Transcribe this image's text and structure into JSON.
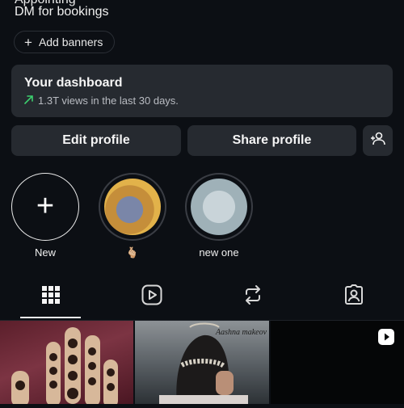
{
  "profile": {
    "bio_cut": "Appointing",
    "bio_line": "DM for bookings",
    "add_banners_label": "Add banners"
  },
  "dashboard": {
    "title": "Your dashboard",
    "subtitle": "1.3T views in the last 30 days.",
    "trend_icon": "trend-up-icon",
    "trend_color": "#3ccf6e"
  },
  "actions": {
    "edit_profile": "Edit profile",
    "share_profile": "Share profile",
    "add_user_icon": "add-person-icon"
  },
  "highlights": [
    {
      "label": "New",
      "icon": "plus-icon"
    },
    {
      "label": "🫰🏼",
      "icon": "highlight-thumbnail"
    },
    {
      "label": "new one",
      "icon": "highlight-thumbnail"
    }
  ],
  "tabs": [
    {
      "name": "grid",
      "icon": "grid-icon",
      "active": true
    },
    {
      "name": "reels",
      "icon": "reels-icon",
      "active": false
    },
    {
      "name": "reposts",
      "icon": "repost-icon",
      "active": false
    },
    {
      "name": "tagged",
      "icon": "tagged-icon",
      "active": false
    }
  ],
  "posts": [
    {
      "kind": "image",
      "icon": ""
    },
    {
      "kind": "image",
      "watermark": "Aashna makeov"
    },
    {
      "kind": "reel",
      "icon": "reel-play-icon"
    }
  ]
}
